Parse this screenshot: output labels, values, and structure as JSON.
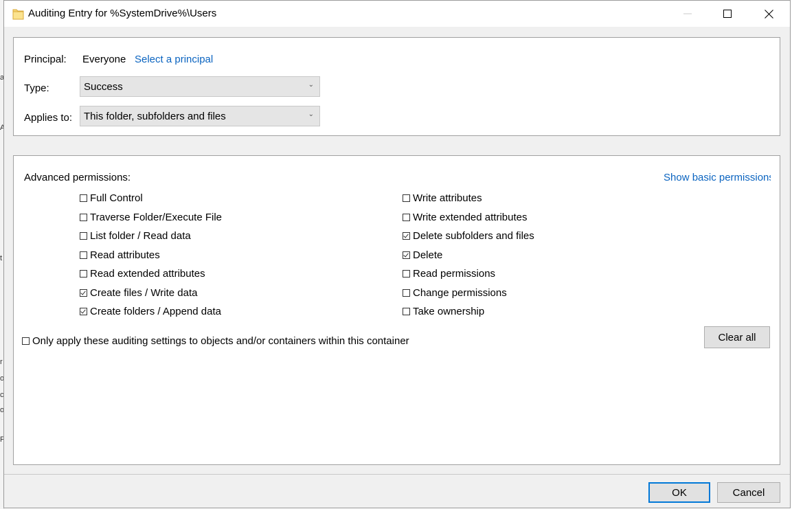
{
  "window": {
    "title": "Auditing Entry for %SystemDrive%\\Users"
  },
  "background_chars": [
    "a",
    "A",
    "t",
    "r",
    "o",
    "c",
    "o",
    "F"
  ],
  "principal": {
    "label": "Principal:",
    "value": "Everyone",
    "link": "Select a principal"
  },
  "type": {
    "label": "Type:",
    "selected": "Success"
  },
  "applies_to": {
    "label": "Applies to:",
    "selected": "This folder, subfolders and files"
  },
  "advanced": {
    "heading": "Advanced permissions:",
    "show_basic_link": "Show basic permissions",
    "left_column": [
      {
        "label": "Full Control",
        "checked": false
      },
      {
        "label": "Traverse Folder/Execute File",
        "checked": false
      },
      {
        "label": "List folder / Read data",
        "checked": false
      },
      {
        "label": "Read attributes",
        "checked": false
      },
      {
        "label": "Read extended attributes",
        "checked": false
      },
      {
        "label": "Create files / Write data",
        "checked": true
      },
      {
        "label": "Create folders / Append data",
        "checked": true
      }
    ],
    "right_column": [
      {
        "label": "Write attributes",
        "checked": false
      },
      {
        "label": "Write extended attributes",
        "checked": false
      },
      {
        "label": "Delete subfolders and files",
        "checked": true
      },
      {
        "label": "Delete",
        "checked": true
      },
      {
        "label": "Read permissions",
        "checked": false
      },
      {
        "label": "Change permissions",
        "checked": false
      },
      {
        "label": "Take ownership",
        "checked": false
      }
    ],
    "only_apply": {
      "label": "Only apply these auditing settings to objects and/or containers within this container",
      "checked": false
    },
    "clear_all": "Clear all"
  },
  "footer": {
    "ok": "OK",
    "cancel": "Cancel"
  }
}
